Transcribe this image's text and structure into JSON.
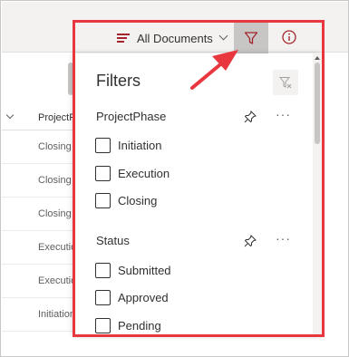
{
  "toolbar": {
    "view_label": "All Documents",
    "view_icon": "list-lines-icon",
    "filter_icon": "filter-icon",
    "info_icon": "info-icon",
    "accent": "#a4262c"
  },
  "list": {
    "column_header": "ProjectPhase",
    "rows": [
      "Closing",
      "Closing",
      "Closing",
      "Execution",
      "Execution",
      "Initiation"
    ]
  },
  "filters": {
    "title": "Filters",
    "clear_icon": "clear-filter-icon",
    "sections": [
      {
        "title": "ProjectPhase",
        "options": [
          "Initiation",
          "Execution",
          "Closing"
        ]
      },
      {
        "title": "Status",
        "options": [
          "Submitted",
          "Approved",
          "Pending"
        ]
      }
    ],
    "more_label": "···"
  },
  "annotation": {
    "highlight_color": "#e8373e"
  }
}
